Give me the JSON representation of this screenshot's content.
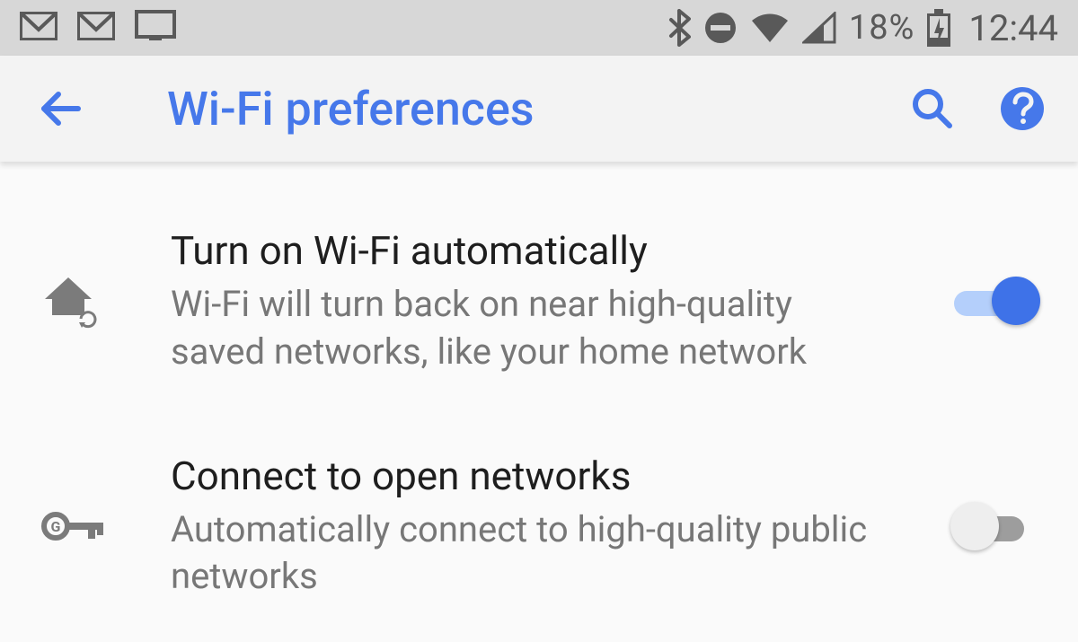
{
  "status": {
    "battery_percent": "18%",
    "time": "12:44"
  },
  "appbar": {
    "title": "Wi-Fi preferences"
  },
  "colors": {
    "accent": "#3e72e8",
    "accent_light": "#b4cffb",
    "text_primary": "#1e1e1e",
    "text_secondary": "#777777"
  },
  "settings": [
    {
      "icon": "home-sync",
      "title": "Turn on Wi-Fi automatically",
      "subtitle": "Wi-Fi will turn back on near high-quality saved networks, like your home network",
      "toggle": true
    },
    {
      "icon": "key",
      "title": "Connect to open networks",
      "subtitle": "Automatically connect to high-quality public networks",
      "toggle": false
    }
  ]
}
